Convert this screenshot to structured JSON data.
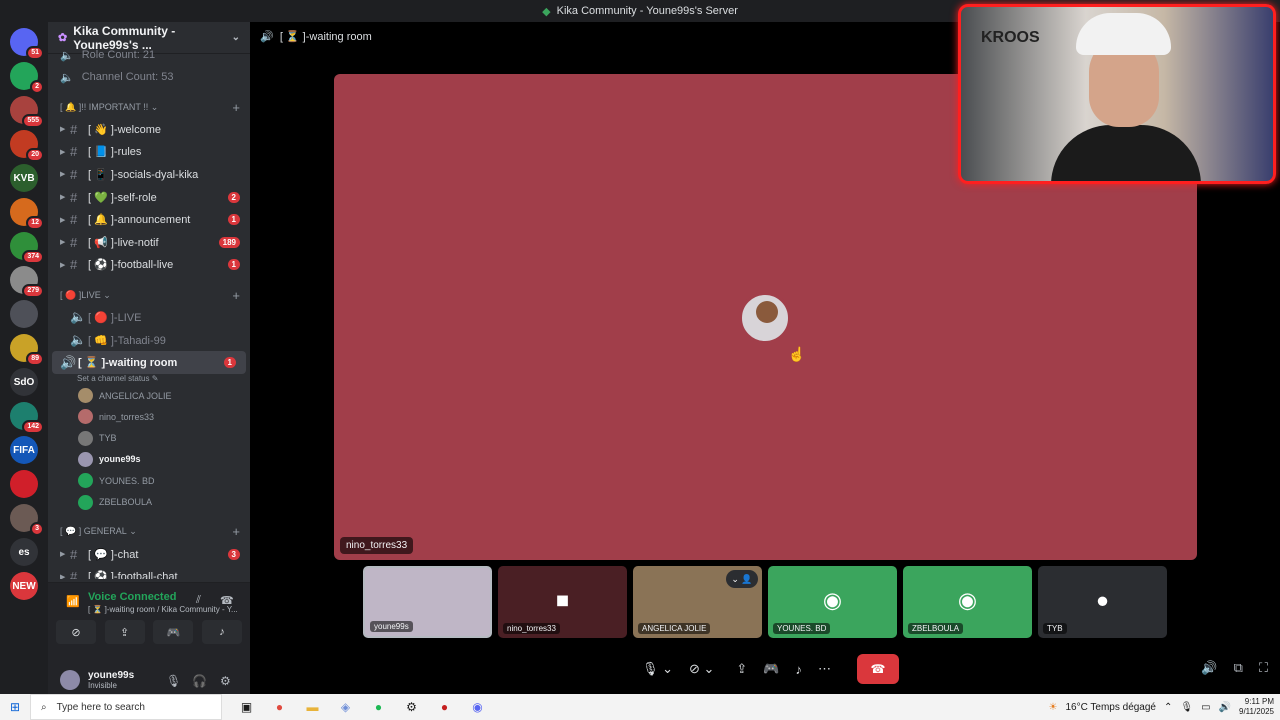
{
  "window": {
    "title": "Kika Community - Youne99s's Server"
  },
  "servers": [
    {
      "label": "",
      "badge": "51",
      "color": "#5865f2"
    },
    {
      "label": "",
      "badge": "2",
      "color": "#23a55a"
    },
    {
      "label": "",
      "badge": "555",
      "color": "#a8423e"
    },
    {
      "label": "",
      "badge": "20",
      "color": "#c23b22"
    },
    {
      "label": "KVB",
      "badge": "",
      "color": "#2c5f2d"
    },
    {
      "label": "",
      "badge": "12",
      "color": "#d66a1d"
    },
    {
      "label": "",
      "badge": "374",
      "color": "#2f8f3a"
    },
    {
      "label": "",
      "badge": "279",
      "color": "#8b8b8b"
    },
    {
      "label": "",
      "badge": "",
      "color": "#4e5058"
    },
    {
      "label": "",
      "badge": "89",
      "color": "#c9a227"
    },
    {
      "label": "SdO",
      "badge": "",
      "color": "#313338"
    },
    {
      "label": "",
      "badge": "142",
      "color": "#1d7f6e"
    },
    {
      "label": "FIFA",
      "badge": "",
      "color": "#1457b8"
    },
    {
      "label": "",
      "badge": "",
      "color": "#d01f2a"
    },
    {
      "label": "",
      "badge": "3",
      "color": "#6b5a54"
    },
    {
      "label": "es",
      "badge": "",
      "color": "#313338"
    },
    {
      "label": "NEW",
      "badge": "",
      "color": "#da373c"
    }
  ],
  "sidebar": {
    "server_name": "Kika Community - Youne99s's ...",
    "stats": [
      "Role Count: 21",
      "Channel Count: 53"
    ],
    "categories": [
      {
        "name": "[ 🔔 ]!! IMPORTANT !!",
        "channels": [
          {
            "name": "[ 👋 ]-welcome",
            "badge": ""
          },
          {
            "name": "[ 📘 ]-rules",
            "badge": ""
          },
          {
            "name": "[ 📱 ]-socials-dyal-kika",
            "badge": ""
          },
          {
            "name": "[ 💚 ]-self-role",
            "badge": "2"
          },
          {
            "name": "[ 🔔 ]-announcement",
            "badge": "1"
          },
          {
            "name": "[ 📢 ]-live-notif",
            "badge": "189"
          },
          {
            "name": "[ ⚽ ]-football-live",
            "badge": "1"
          }
        ]
      },
      {
        "name": "[ 🔴 ]LIVE",
        "channels": [
          {
            "name": "[ 🔴 ]-LIVE",
            "badge": ""
          },
          {
            "name": "[ 👊 ]-Tahadi-99",
            "badge": ""
          },
          {
            "name": "[ ⏳ ]-waiting room",
            "badge": "1"
          }
        ],
        "voice_status": "Set a channel status",
        "voice_users": [
          "ANGELICA JOLIE",
          "nino_torres33",
          "TYB",
          "youne99s",
          "YOUNES. BD",
          "ZBELBOULA"
        ]
      },
      {
        "name": "[ 💬 ] GENERAL",
        "channels": [
          {
            "name": "[ 💬 ]-chat",
            "badge": "3"
          },
          {
            "name": "[ ⚽ ]-football-chat",
            "badge": ""
          }
        ]
      }
    ]
  },
  "voice_panel": {
    "title": "Voice Connected",
    "subtitle": "[ ⏳ ]-waiting room / Kika Community - Y..."
  },
  "user_panel": {
    "name": "youne99s",
    "status": "Invisible"
  },
  "main": {
    "channel_title": "[ ⏳ ]-waiting room",
    "stage_user": "nino_torres33",
    "stage_color": "#a13e4a",
    "tiles": [
      {
        "name": "youne99s",
        "bg": "#bfb6c6",
        "icon": ""
      },
      {
        "name": "nino_torres33",
        "bg": "#4a1f24",
        "icon": "■"
      },
      {
        "name": "ANGELICA JOLIE",
        "bg": "#8a7356",
        "icon": ""
      },
      {
        "name": "YOUNES. BD",
        "bg": "#3ba55d",
        "icon": "◉"
      },
      {
        "name": "ZBELBOULA",
        "bg": "#3ba55d",
        "icon": "◉"
      },
      {
        "name": "TYB",
        "bg": "#2b2d31",
        "icon": "●"
      }
    ]
  },
  "webcam": {
    "jersey_text": "KROOS"
  },
  "taskbar": {
    "search_placeholder": "Type here to search",
    "weather": "16°C Temps dégagé",
    "time": "9:11 PM",
    "date": "9/11/2025"
  }
}
